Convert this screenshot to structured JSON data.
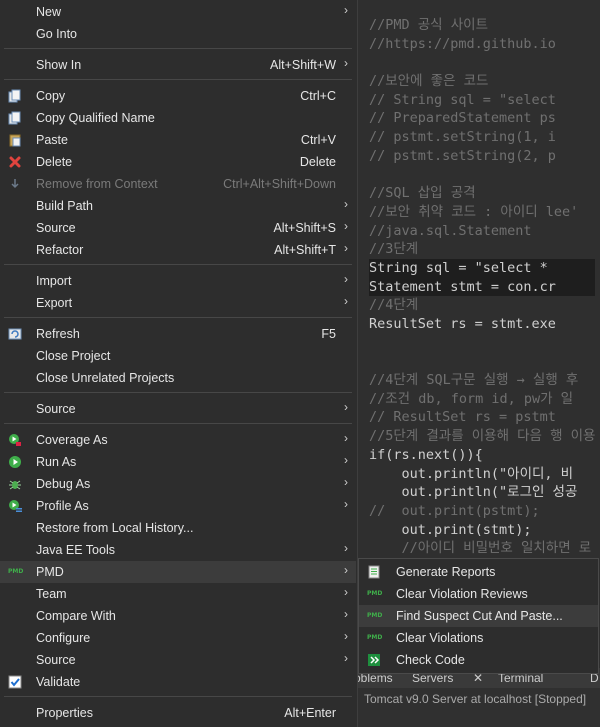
{
  "editor": {
    "lines": [
      {
        "text": "//PMD 공식 사이트",
        "cls": "c-com"
      },
      {
        "text": "//https://pmd.github.io",
        "cls": "c-com"
      },
      {
        "text": "",
        "cls": "c-com"
      },
      {
        "text": "//보안에 좋은 코드",
        "cls": "c-com"
      },
      {
        "text": "// String sql = \"select",
        "cls": "c-com"
      },
      {
        "text": "// PreparedStatement ps",
        "cls": "c-com"
      },
      {
        "text": "// pstmt.setString(1, i",
        "cls": "c-com"
      },
      {
        "text": "// pstmt.setString(2, p",
        "cls": "c-com"
      },
      {
        "text": "",
        "cls": "c-com"
      },
      {
        "text": "//SQL 삽입 공격",
        "cls": "c-com"
      },
      {
        "text": "//보안 취약 코드 : 아이디 lee'",
        "cls": "c-com"
      },
      {
        "text": "//java.sql.Statement",
        "cls": "c-com"
      },
      {
        "text": "//3단계",
        "cls": "c-com"
      },
      {
        "text": "String sql = \"select * ",
        "cls": "c-def hl"
      },
      {
        "text": "Statement stmt = con.cr",
        "cls": "c-def hl"
      },
      {
        "text": "//4단계",
        "cls": "c-com"
      },
      {
        "text": "ResultSet rs = stmt.exe",
        "cls": "c-def"
      },
      {
        "text": "",
        "cls": "c-com"
      },
      {
        "text": "",
        "cls": "c-com"
      },
      {
        "text": "//4단계 SQL구문 실행 → 실행 후",
        "cls": "c-com"
      },
      {
        "text": "//조건 db, form id, pw가 일",
        "cls": "c-com"
      },
      {
        "text": "// ResultSet rs = pstmt",
        "cls": "c-com"
      },
      {
        "text": "//5단계 결과를 이용해 다음 행 이용",
        "cls": "c-com"
      },
      {
        "text": "if(rs.next()){",
        "cls": "c-def"
      },
      {
        "text": "    out.println(\"아이디, 비",
        "cls": "c-def"
      },
      {
        "text": "    out.println(\"로그인 성공",
        "cls": "c-def"
      },
      {
        "text": "//  out.print(pstmt);",
        "cls": "c-com"
      },
      {
        "text": "    out.print(stmt);",
        "cls": "c-def"
      },
      {
        "text": "    //아이디 비밀번호 일치하면 로",
        "cls": "c-com"
      }
    ]
  },
  "views": {
    "tabs": [
      "oblems",
      "Servers",
      "✕",
      "Terminal",
      "D"
    ],
    "status": "Tomcat v9.0 Server at localhost  [Stopped]"
  },
  "menu": {
    "items": [
      {
        "label": "New",
        "accel": "",
        "arrow": true,
        "icon": "",
        "disabled": false
      },
      {
        "label": "Go Into",
        "accel": "",
        "arrow": false,
        "icon": "",
        "disabled": false
      },
      {
        "label": "Show In",
        "accel": "Alt+Shift+W",
        "arrow": true,
        "icon": "",
        "disabled": false
      },
      {
        "label": "Copy",
        "accel": "Ctrl+C",
        "arrow": false,
        "icon": "copy-icon",
        "disabled": false
      },
      {
        "label": "Copy Qualified Name",
        "accel": "",
        "arrow": false,
        "icon": "copy-qualified-icon",
        "disabled": false
      },
      {
        "label": "Paste",
        "accel": "Ctrl+V",
        "arrow": false,
        "icon": "paste-icon",
        "disabled": false
      },
      {
        "label": "Delete",
        "accel": "Delete",
        "arrow": false,
        "icon": "delete-icon",
        "disabled": false
      },
      {
        "label": "Remove from Context",
        "accel": "Ctrl+Alt+Shift+Down",
        "arrow": false,
        "icon": "remove-context-icon",
        "disabled": true
      },
      {
        "label": "Build Path",
        "accel": "",
        "arrow": true,
        "icon": "",
        "disabled": false
      },
      {
        "label": "Source",
        "accel": "Alt+Shift+S",
        "arrow": true,
        "icon": "",
        "disabled": false
      },
      {
        "label": "Refactor",
        "accel": "Alt+Shift+T",
        "arrow": true,
        "icon": "",
        "disabled": false
      },
      {
        "label": "Import",
        "accel": "",
        "arrow": true,
        "icon": "",
        "disabled": false
      },
      {
        "label": "Export",
        "accel": "",
        "arrow": true,
        "icon": "",
        "disabled": false
      },
      {
        "label": "Refresh",
        "accel": "F5",
        "arrow": false,
        "icon": "refresh-icon",
        "disabled": false
      },
      {
        "label": "Close Project",
        "accel": "",
        "arrow": false,
        "icon": "",
        "disabled": false
      },
      {
        "label": "Close Unrelated Projects",
        "accel": "",
        "arrow": false,
        "icon": "",
        "disabled": false
      },
      {
        "label": "Source",
        "accel": "",
        "arrow": true,
        "icon": "",
        "disabled": false
      },
      {
        "label": "Coverage As",
        "accel": "",
        "arrow": true,
        "icon": "coverage-icon",
        "disabled": false
      },
      {
        "label": "Run As",
        "accel": "",
        "arrow": true,
        "icon": "run-icon",
        "disabled": false
      },
      {
        "label": "Debug As",
        "accel": "",
        "arrow": true,
        "icon": "debug-icon",
        "disabled": false
      },
      {
        "label": "Profile As",
        "accel": "",
        "arrow": true,
        "icon": "profile-icon",
        "disabled": false
      },
      {
        "label": "Restore from Local History...",
        "accel": "",
        "arrow": false,
        "icon": "",
        "disabled": false
      },
      {
        "label": "Java EE Tools",
        "accel": "",
        "arrow": true,
        "icon": "",
        "disabled": false
      },
      {
        "label": "PMD",
        "accel": "",
        "arrow": true,
        "icon": "pmd-icon",
        "disabled": false
      },
      {
        "label": "Team",
        "accel": "",
        "arrow": true,
        "icon": "",
        "disabled": false
      },
      {
        "label": "Compare With",
        "accel": "",
        "arrow": true,
        "icon": "",
        "disabled": false
      },
      {
        "label": "Configure",
        "accel": "",
        "arrow": true,
        "icon": "",
        "disabled": false
      },
      {
        "label": "Source",
        "accel": "",
        "arrow": true,
        "icon": "",
        "disabled": false
      },
      {
        "label": "Validate",
        "accel": "",
        "arrow": false,
        "icon": "checkbox-checked-icon",
        "disabled": false
      },
      {
        "label": "Properties",
        "accel": "Alt+Enter",
        "arrow": false,
        "icon": "",
        "disabled": false
      }
    ],
    "pmd_icon_text": "PMD"
  },
  "pmd_submenu": {
    "items": [
      {
        "label": "Generate Reports",
        "icon": "report-icon"
      },
      {
        "label": "Clear Violation Reviews",
        "icon": "pmd-icon"
      },
      {
        "label": "Find Suspect Cut And Paste...",
        "icon": "pmd-icon"
      },
      {
        "label": "Clear Violations",
        "icon": "pmd-icon"
      },
      {
        "label": "Check Code",
        "icon": "check-code-icon"
      }
    ]
  },
  "colors": {
    "accent_green": "#3fae4a",
    "delete_red": "#e0443e",
    "menu_bg": "#2d2d2d",
    "editor_bg": "#2f2f2f"
  }
}
